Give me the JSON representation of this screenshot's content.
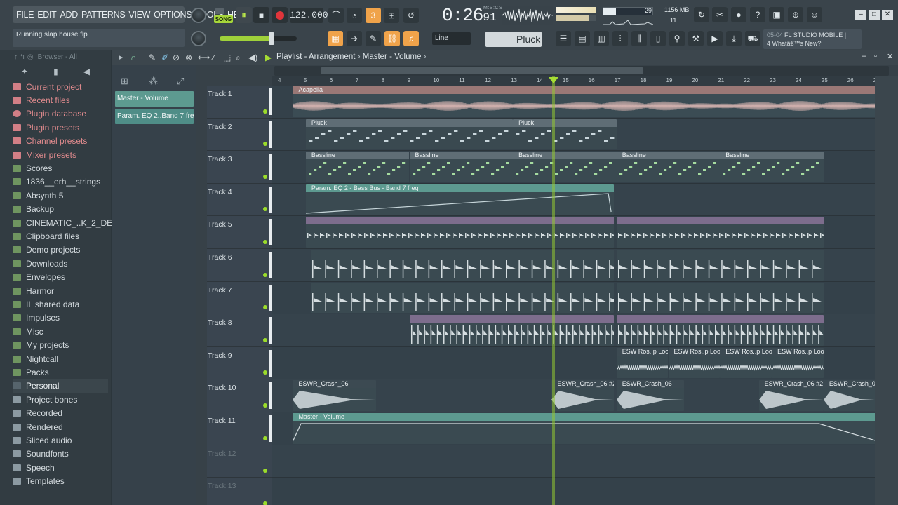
{
  "menu": [
    "FILE",
    "EDIT",
    "ADD",
    "PATTERNS",
    "VIEW",
    "OPTIONS",
    "TOOLS",
    "HELP"
  ],
  "hint": "Running slap house.flp",
  "transport": {
    "mode": "SONG",
    "pause_icon": "⏸",
    "stop_icon": "■",
    "tempo": "122.000"
  },
  "time": {
    "main": "0:26",
    "sub": "91",
    "unit": "M:S:CS"
  },
  "monitor": {
    "cpu": "29",
    "memory": "1156 MB",
    "polyphony": "11"
  },
  "snap": "Line",
  "pattern": "Pluck",
  "news": {
    "date": "05-04",
    "line1": "FL STUDIO MOBILE |",
    "line2": "4 Whatâ€™s New?"
  },
  "browser": {
    "header": "Browser - All",
    "items": [
      "Current project",
      "Recent files",
      "Plugin database",
      "Plugin presets",
      "Channel presets",
      "Mixer presets",
      "Scores",
      "1836__erh__strings",
      "Absynth 5",
      "Backup",
      "CINEMATIC_..K_2_DEMOS",
      "Clipboard files",
      "Demo projects",
      "Downloads",
      "Envelopes",
      "Harmor",
      "IL shared data",
      "Impulses",
      "Misc",
      "My projects",
      "Nightcall",
      "Packs",
      "Personal",
      "Project bones",
      "Recorded",
      "Rendered",
      "Sliced audio",
      "Soundfonts",
      "Speech",
      "Templates"
    ]
  },
  "playlist": {
    "title": "Playlist - Arrangement",
    "context": "Master - Volume",
    "clip_list": [
      "Master - Volume",
      "Param. EQ 2..Band 7 freq"
    ],
    "ticks": [
      "4",
      "5",
      "6",
      "7",
      "8",
      "9",
      "10",
      "11",
      "12",
      "13",
      "14",
      "15",
      "16",
      "17",
      "18",
      "19",
      "20",
      "21",
      "22",
      "23",
      "24",
      "25",
      "26",
      "27"
    ],
    "tracks": [
      "Track 1",
      "Track 2",
      "Track 3",
      "Track 4",
      "Track 5",
      "Track 6",
      "Track 7",
      "Track 8",
      "Track 9",
      "Track 10",
      "Track 11",
      "Track 12",
      "Track 13"
    ],
    "clip_labels": {
      "acapella": "Acapella",
      "pluck": "Pluck",
      "bassline": "Bassline",
      "eq_auto": "Param. EQ 2 - Bass Bus - Band 7 freq",
      "esw_loop": "ESW Ros..p Loop",
      "crash": "ESWR_Crash_06",
      "crash2": "ESWR_Crash_06 #2",
      "master_auto": "Master - Volume"
    }
  },
  "colors": {
    "accent_green": "#9bdc2a",
    "audio_clip": "#c3a5a4",
    "pattern_clip": "#5a6a72",
    "automation_clip": "#5d9a90",
    "drum_clip": "#7d6d8d"
  }
}
